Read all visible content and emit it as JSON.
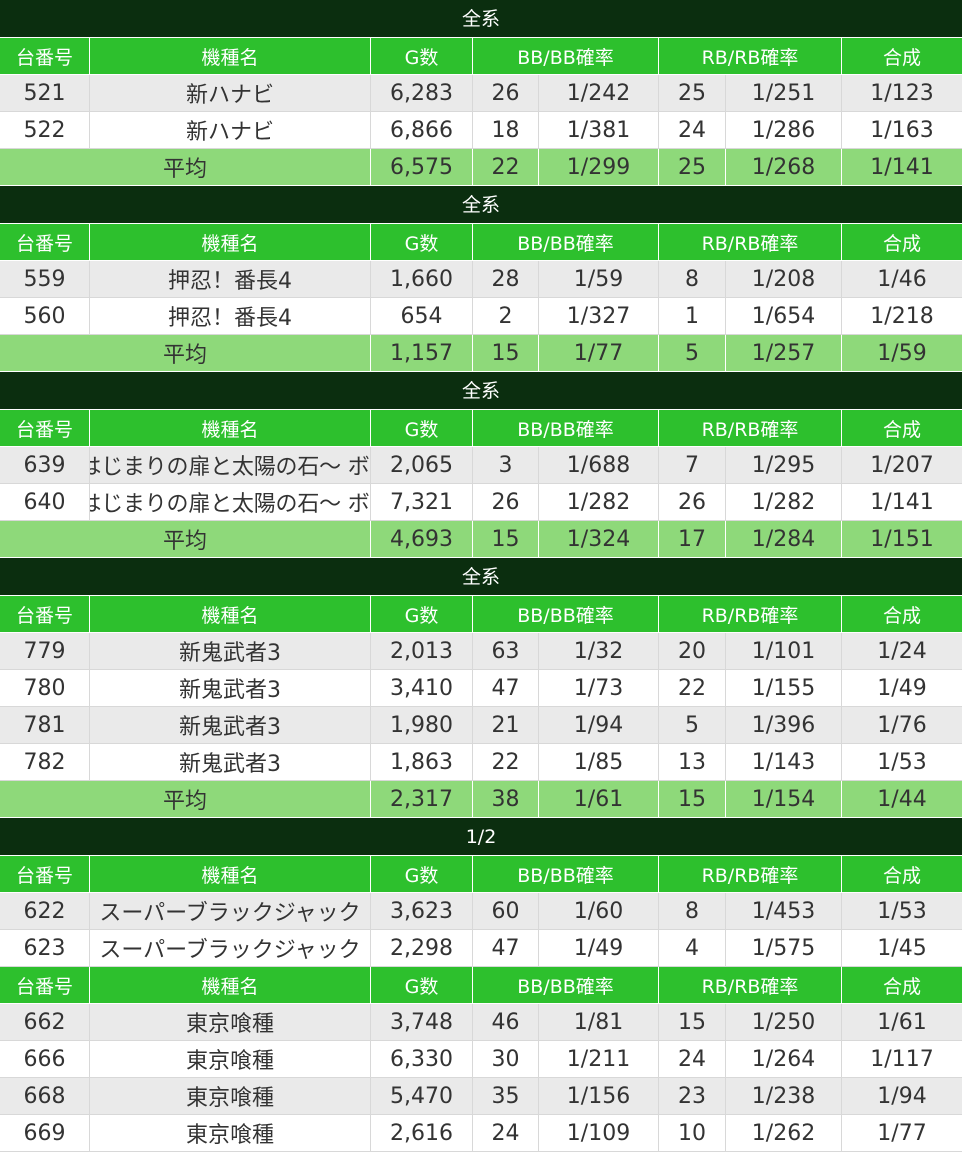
{
  "headers": {
    "machine_no": "台番号",
    "machine_name": "機種名",
    "games": "G数",
    "bb": "BB/BB確率",
    "rb": "RB/RB確率",
    "total": "合成"
  },
  "avg_label": "平均",
  "sections": [
    {
      "title": "全系",
      "rows": [
        {
          "no": "521",
          "name": "新ハナビ",
          "g": "6,283",
          "bb": "26",
          "bbp": "1/242",
          "rb": "25",
          "rbp": "1/251",
          "total": "1/123"
        },
        {
          "no": "522",
          "name": "新ハナビ",
          "g": "6,866",
          "bb": "18",
          "bbp": "1/381",
          "rb": "24",
          "rbp": "1/286",
          "total": "1/163"
        }
      ],
      "avg": {
        "g": "6,575",
        "bb": "22",
        "bbp": "1/299",
        "rb": "25",
        "rbp": "1/268",
        "total": "1/141"
      }
    },
    {
      "title": "全系",
      "rows": [
        {
          "no": "559",
          "name": "押忍！番長4",
          "g": "1,660",
          "bb": "28",
          "bbp": "1/59",
          "rb": "8",
          "rbp": "1/208",
          "total": "1/46"
        },
        {
          "no": "560",
          "name": "押忍！番長4",
          "g": "654",
          "bb": "2",
          "bbp": "1/327",
          "rb": "1",
          "rbp": "1/654",
          "total": "1/218"
        }
      ],
      "avg": {
        "g": "1,157",
        "bb": "15",
        "bbp": "1/77",
        "rb": "5",
        "rbp": "1/257",
        "total": "1/59"
      }
    },
    {
      "title": "全系",
      "rows": [
        {
          "no": "639",
          "name": "クレアの秘宝伝 ～はじまりの扉と太陽の石～ ボーナストリガーver.",
          "g": "2,065",
          "bb": "3",
          "bbp": "1/688",
          "rb": "7",
          "rbp": "1/295",
          "total": "1/207",
          "tiny": true
        },
        {
          "no": "640",
          "name": "クレアの秘宝伝 ～はじまりの扉と太陽の石～ ボーナストリガーver.",
          "g": "7,321",
          "bb": "26",
          "bbp": "1/282",
          "rb": "26",
          "rbp": "1/282",
          "total": "1/141",
          "tiny": true
        }
      ],
      "avg": {
        "g": "4,693",
        "bb": "15",
        "bbp": "1/324",
        "rb": "17",
        "rbp": "1/284",
        "total": "1/151"
      }
    },
    {
      "title": "全系",
      "rows": [
        {
          "no": "779",
          "name": "新鬼武者3",
          "g": "2,013",
          "bb": "63",
          "bbp": "1/32",
          "rb": "20",
          "rbp": "1/101",
          "total": "1/24"
        },
        {
          "no": "780",
          "name": "新鬼武者3",
          "g": "3,410",
          "bb": "47",
          "bbp": "1/73",
          "rb": "22",
          "rbp": "1/155",
          "total": "1/49"
        },
        {
          "no": "781",
          "name": "新鬼武者3",
          "g": "1,980",
          "bb": "21",
          "bbp": "1/94",
          "rb": "5",
          "rbp": "1/396",
          "total": "1/76"
        },
        {
          "no": "782",
          "name": "新鬼武者3",
          "g": "1,863",
          "bb": "22",
          "bbp": "1/85",
          "rb": "13",
          "rbp": "1/143",
          "total": "1/53"
        }
      ],
      "avg": {
        "g": "2,317",
        "bb": "38",
        "bbp": "1/61",
        "rb": "15",
        "rbp": "1/154",
        "total": "1/44"
      }
    },
    {
      "title": "1/2",
      "rows": [
        {
          "no": "622",
          "name": "スーパーブラックジャック",
          "g": "3,623",
          "bb": "60",
          "bbp": "1/60",
          "rb": "8",
          "rbp": "1/453",
          "total": "1/53"
        },
        {
          "no": "623",
          "name": "スーパーブラックジャック",
          "g": "2,298",
          "bb": "47",
          "bbp": "1/49",
          "rb": "4",
          "rbp": "1/575",
          "total": "1/45"
        }
      ]
    },
    {
      "title": "",
      "rows": [
        {
          "no": "662",
          "name": "東京喰種",
          "g": "3,748",
          "bb": "46",
          "bbp": "1/81",
          "rb": "15",
          "rbp": "1/250",
          "total": "1/61"
        },
        {
          "no": "666",
          "name": "東京喰種",
          "g": "6,330",
          "bb": "30",
          "bbp": "1/211",
          "rb": "24",
          "rbp": "1/264",
          "total": "1/117"
        },
        {
          "no": "668",
          "name": "東京喰種",
          "g": "5,470",
          "bb": "35",
          "bbp": "1/156",
          "rb": "23",
          "rbp": "1/238",
          "total": "1/94"
        },
        {
          "no": "669",
          "name": "東京喰種",
          "g": "2,616",
          "bb": "24",
          "bbp": "1/109",
          "rb": "10",
          "rbp": "1/262",
          "total": "1/77"
        }
      ]
    }
  ],
  "colors": {
    "section_bg": "#0b2e0f",
    "header_bg": "#2dc02d",
    "avg_bg": "#8ed97a",
    "row_alt_bg": "#eaeaea"
  }
}
